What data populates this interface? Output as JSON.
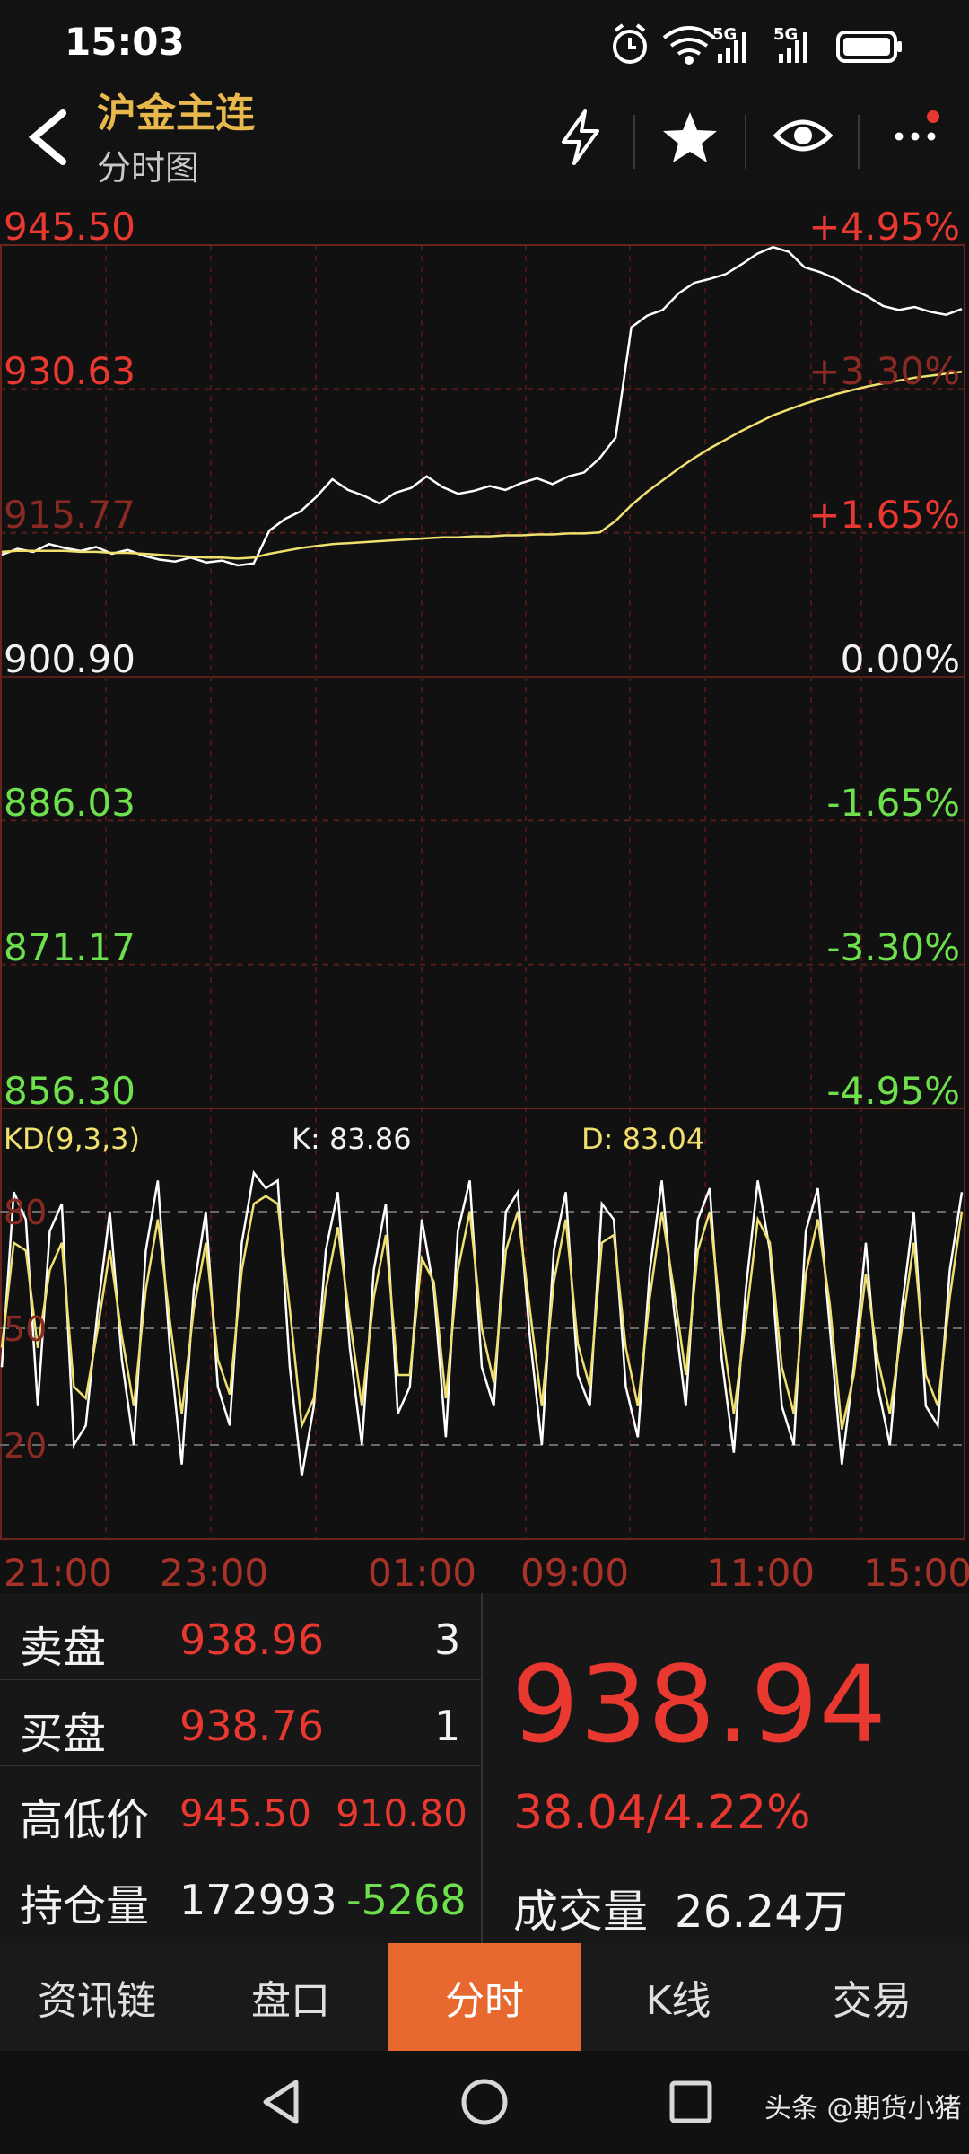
{
  "status_bar": {
    "time": "15:03",
    "net1": "5G",
    "net2": "5G"
  },
  "header": {
    "title": "沪金主连",
    "subtitle": "分时图"
  },
  "price_axis_left": [
    "945.50",
    "930.63",
    "915.77",
    "900.90",
    "886.03",
    "871.17",
    "856.30"
  ],
  "price_axis_right": [
    "+4.95%",
    "+3.30%",
    "+1.65%",
    "0.00%",
    "-1.65%",
    "-3.30%",
    "-4.95%"
  ],
  "kd": {
    "label": "KD(9,3,3)",
    "k": "K: 83.86",
    "d": "D: 83.04",
    "levels": [
      "80",
      "50",
      "20"
    ]
  },
  "time_axis": [
    "21:00",
    "23:00",
    "01:00",
    "09:00",
    "11:00",
    "15:00"
  ],
  "quote": {
    "sell_label": "卖盘",
    "sell_price": "938.96",
    "sell_qty": "3",
    "buy_label": "买盘",
    "buy_price": "938.76",
    "buy_qty": "1",
    "hl_label": "高低价",
    "high": "945.50",
    "low": "910.80",
    "oi_label": "持仓量",
    "oi": "172993",
    "oi_change": "-5268",
    "last": "938.94",
    "change": "38.04/4.22%",
    "vol_label": "成交量",
    "vol": "26.24万"
  },
  "tabs": [
    "资讯链",
    "盘口",
    "分时",
    "K线",
    "交易"
  ],
  "active_tab": "分时",
  "credit": "头条 @期货小猪",
  "chart_data": {
    "type": "line",
    "series": [
      {
        "name": "price",
        "values": [
          913.5,
          914.1,
          913.8,
          914.6,
          914.2,
          913.9,
          914.3,
          913.6,
          914.0,
          913.4,
          913.0,
          912.8,
          913.2,
          912.7,
          912.9,
          912.4,
          912.6,
          916.0,
          917.2,
          918.0,
          919.5,
          921.3,
          920.2,
          919.6,
          918.8,
          919.9,
          920.4,
          921.6,
          920.5,
          919.8,
          920.1,
          920.6,
          920.2,
          920.9,
          921.4,
          920.8,
          921.6,
          922.0,
          923.5,
          925.6,
          937.0,
          938.2,
          938.8,
          940.5,
          941.6,
          942.0,
          942.5,
          943.5,
          944.6,
          945.3,
          944.8,
          943.2,
          942.7,
          942.0,
          941.0,
          940.2,
          939.2,
          938.8,
          939.1,
          938.6,
          938.3,
          938.9
        ]
      },
      {
        "name": "avg",
        "values": [
          913.8,
          913.9,
          913.9,
          913.9,
          913.9,
          913.8,
          913.8,
          913.7,
          913.7,
          913.6,
          913.5,
          913.4,
          913.3,
          913.2,
          913.2,
          913.1,
          913.2,
          913.6,
          913.9,
          914.2,
          914.4,
          914.6,
          914.7,
          914.8,
          914.9,
          915.0,
          915.1,
          915.2,
          915.3,
          915.3,
          915.4,
          915.4,
          915.5,
          915.5,
          915.6,
          915.6,
          915.7,
          915.7,
          915.8,
          917.0,
          918.6,
          920.0,
          921.2,
          922.4,
          923.5,
          924.5,
          925.4,
          926.3,
          927.1,
          927.9,
          928.5,
          929.1,
          929.6,
          930.1,
          930.5,
          930.9,
          931.2,
          931.5,
          931.8,
          932.0,
          932.2,
          932.4
        ]
      }
    ],
    "ylim": [
      856.3,
      945.5
    ]
  },
  "kd_data": {
    "k": [
      40,
      85,
      78,
      30,
      75,
      82,
      20,
      25,
      55,
      80,
      42,
      20,
      70,
      88,
      45,
      15,
      60,
      80,
      35,
      25,
      72,
      90,
      86,
      88,
      40,
      12,
      30,
      70,
      85,
      45,
      20,
      65,
      82,
      28,
      35,
      78,
      60,
      22,
      75,
      88,
      40,
      30,
      80,
      85,
      48,
      20,
      70,
      85,
      38,
      30,
      82,
      78,
      35,
      22,
      65,
      88,
      55,
      30,
      78,
      86,
      42,
      18,
      60,
      88,
      70,
      30,
      20,
      75,
      86,
      50,
      15,
      40,
      72,
      35,
      20,
      55,
      80,
      30,
      25,
      65,
      85
    ],
    "d": [
      45,
      72,
      70,
      45,
      65,
      72,
      35,
      32,
      50,
      70,
      48,
      30,
      60,
      78,
      52,
      28,
      55,
      72,
      42,
      33,
      65,
      82,
      84,
      82,
      55,
      25,
      32,
      60,
      76,
      52,
      30,
      58,
      74,
      38,
      38,
      68,
      62,
      32,
      65,
      80,
      50,
      36,
      70,
      80,
      55,
      30,
      62,
      78,
      46,
      35,
      72,
      74,
      45,
      30,
      58,
      80,
      60,
      38,
      70,
      80,
      50,
      28,
      52,
      78,
      72,
      40,
      28,
      64,
      78,
      56,
      24,
      38,
      64,
      42,
      28,
      50,
      72,
      38,
      30,
      58,
      80
    ]
  }
}
